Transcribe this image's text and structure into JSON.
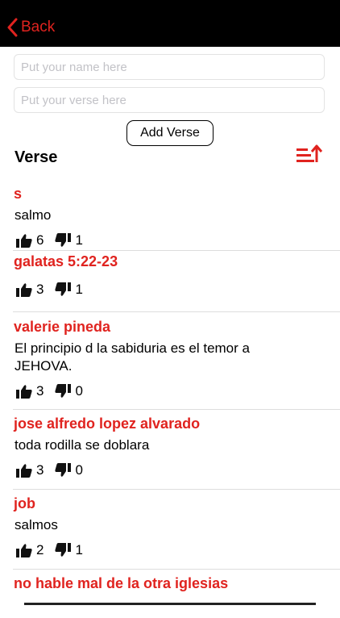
{
  "nav": {
    "back_label": "Back"
  },
  "form": {
    "name_placeholder": "Put your name here",
    "verse_placeholder": "Put your verse here",
    "add_button_label": "Add Verse"
  },
  "section": {
    "title": "Verse"
  },
  "colors": {
    "accent": "#e0231f",
    "navbar": "#000000"
  },
  "icons": {
    "sort": "sort-ascending-icon",
    "like": "thumbs-up-icon",
    "dislike": "thumbs-down-icon",
    "back": "chevron-left-icon"
  },
  "verses": [
    {
      "name": "s",
      "text": "salmo",
      "likes": "6",
      "dislikes": "1"
    },
    {
      "name": "galatas 5:22-23",
      "text": "",
      "likes": "3",
      "dislikes": "1"
    },
    {
      "name": "valerie pineda",
      "text": "El principio d la sabiduria es el temor a JEHOVA.",
      "likes": "3",
      "dislikes": "0"
    },
    {
      "name": "jose alfredo lopez alvarado",
      "text": "toda rodilla se doblara",
      "likes": "3",
      "dislikes": "0"
    },
    {
      "name": "job",
      "text": "salmos",
      "likes": "2",
      "dislikes": "1"
    },
    {
      "name": "no hable mal de la otra iglesias",
      "text": "",
      "likes": "",
      "dislikes": ""
    }
  ]
}
